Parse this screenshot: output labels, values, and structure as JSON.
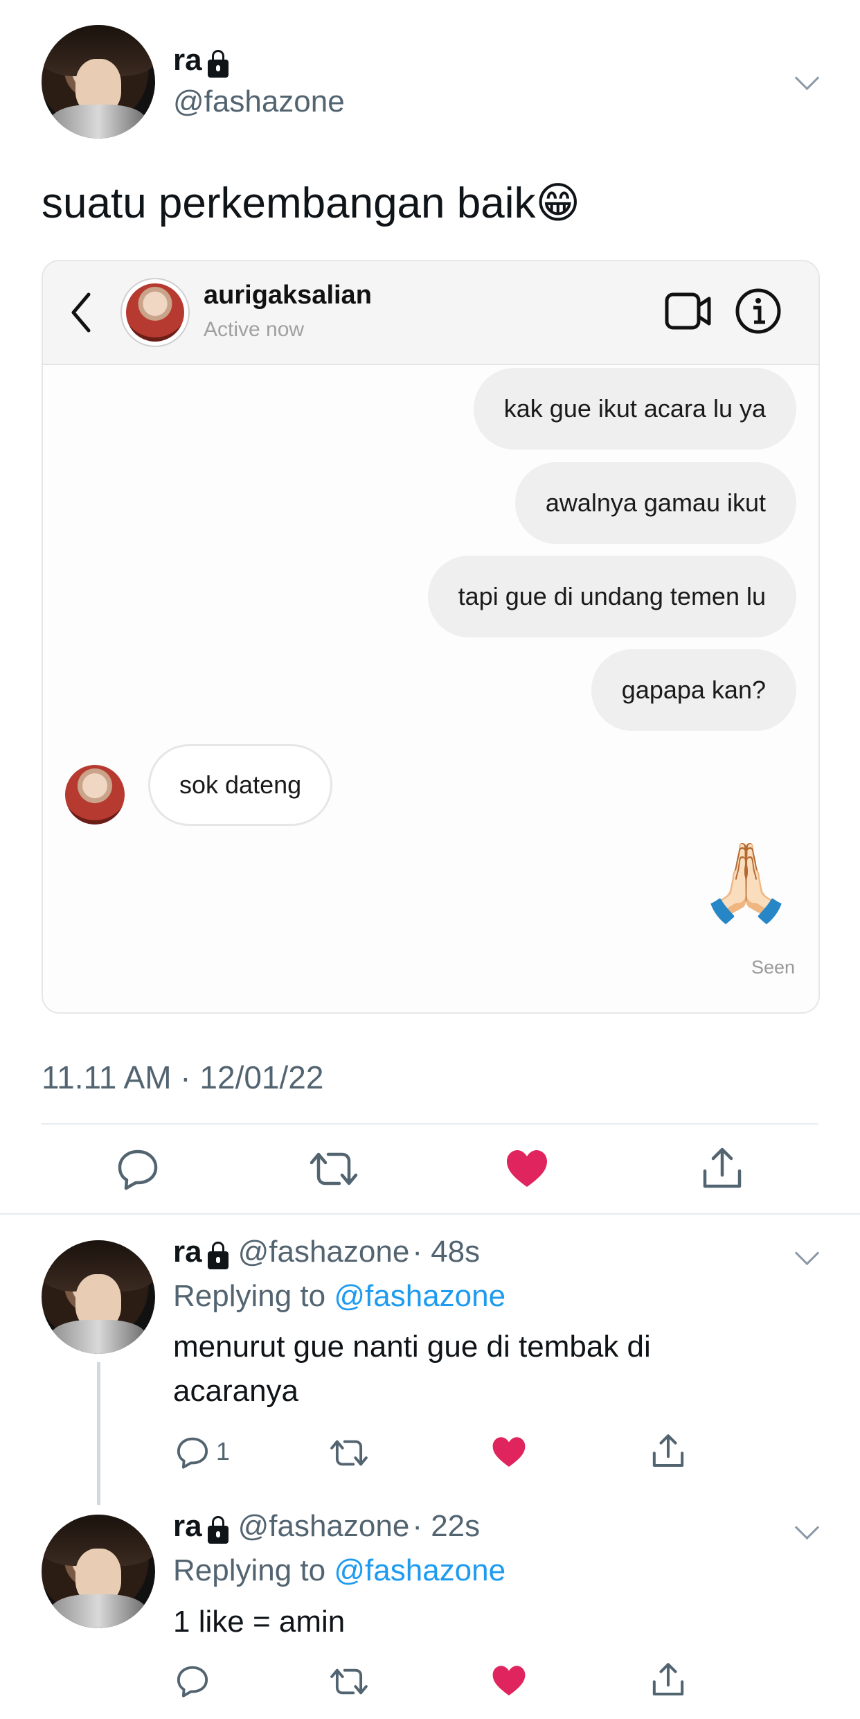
{
  "tweet": {
    "display_name": "ra",
    "handle": "@fashazone",
    "text": "suatu perkembangan baik😁",
    "timestamp": "11.11 AM · 12/01/22"
  },
  "dm": {
    "username": "aurigaksalian",
    "status": "Active now",
    "sent_messages": [
      "kak gue ikut acara lu ya",
      "awalnya gamau ikut",
      "tapi gue di undang temen lu",
      "gapapa kan?"
    ],
    "received_message": "sok dateng",
    "emoji": "🙏🏻",
    "seen_label": "Seen"
  },
  "replies": [
    {
      "display_name": "ra",
      "handle": "@fashazone",
      "age": "· 48s",
      "replying_prefix": "Replying to ",
      "replying_to": "@fashazone",
      "text": "menurut gue nanti gue di tembak di acaranya",
      "reply_count": "1"
    },
    {
      "display_name": "ra",
      "handle": "@fashazone",
      "age": "· 22s",
      "replying_prefix": "Replying to ",
      "replying_to": "@fashazone",
      "text": "1 like = amin",
      "reply_count": ""
    }
  ],
  "colors": {
    "like": "#e0245e",
    "link": "#1d9bf0",
    "muted": "#536471"
  },
  "icons": [
    "lock-icon",
    "chevron-down-icon",
    "back-icon",
    "video-call-icon",
    "info-icon",
    "reply-icon",
    "retweet-icon",
    "like-icon",
    "share-icon"
  ]
}
